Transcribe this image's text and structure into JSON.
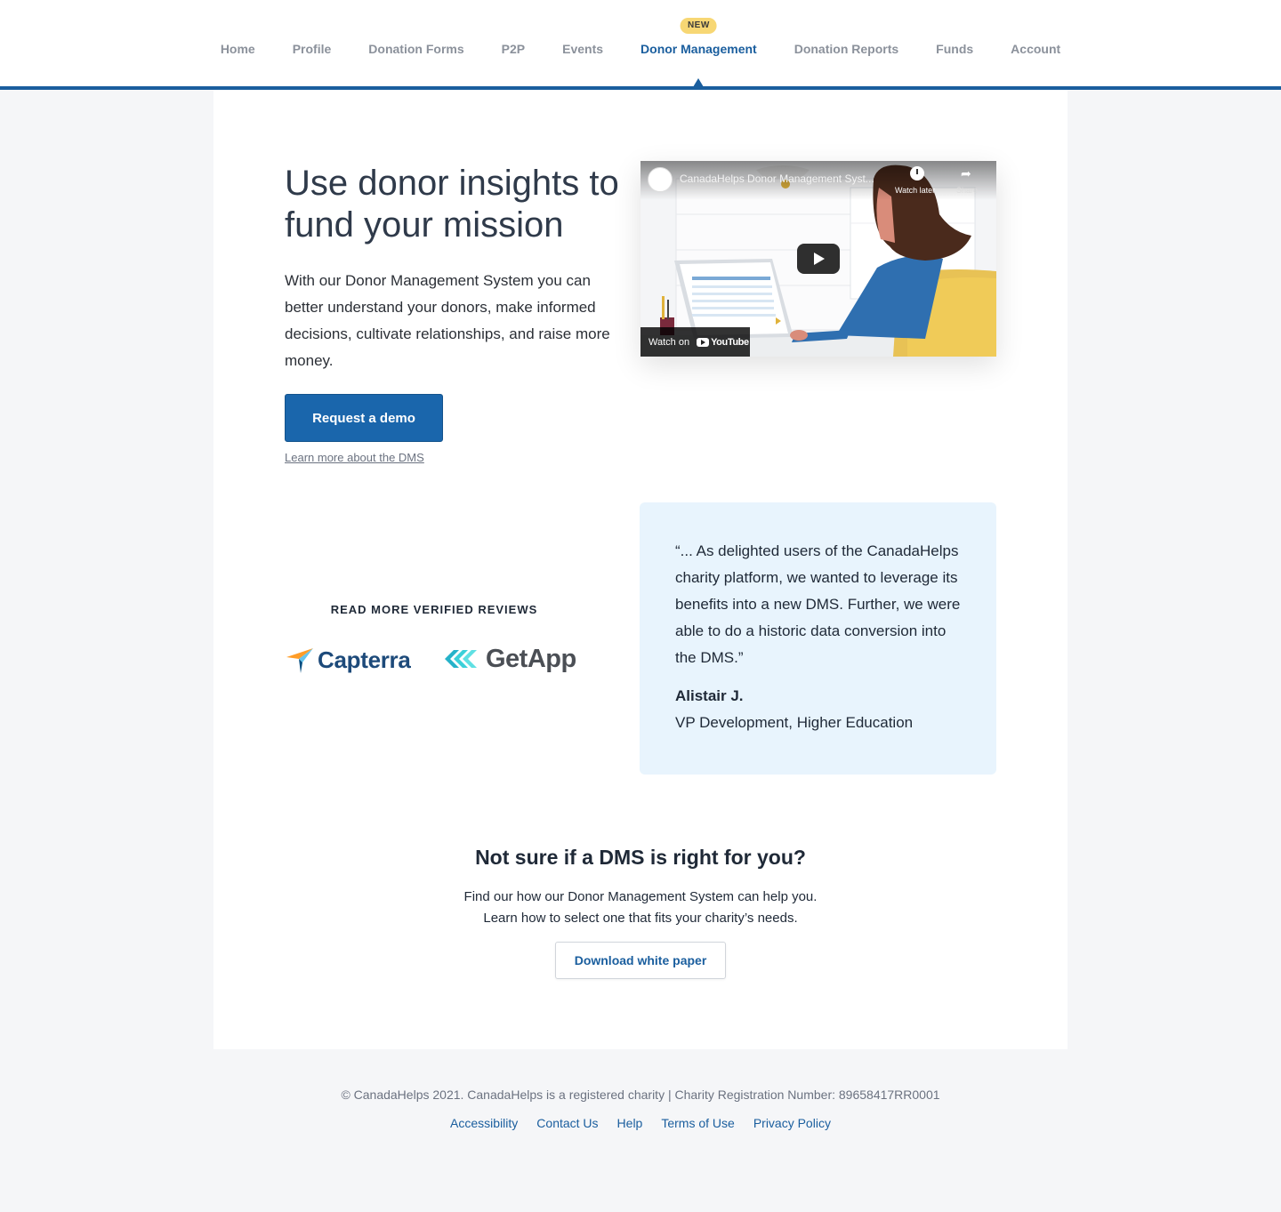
{
  "nav": {
    "items": [
      {
        "label": "Home"
      },
      {
        "label": "Profile"
      },
      {
        "label": "Donation Forms"
      },
      {
        "label": "P2P"
      },
      {
        "label": "Events"
      },
      {
        "label": "Donor Management",
        "badge": "NEW",
        "active": true
      },
      {
        "label": "Donation Reports"
      },
      {
        "label": "Funds"
      },
      {
        "label": "Account"
      }
    ]
  },
  "hero": {
    "title": "Use donor insights to fund your mission",
    "text": "With our Donor Management System you can better understand your donors, make informed decisions, cultivate relationships, and raise more money.",
    "demo_button": "Request a demo",
    "learn_link": "Learn more about the DMS"
  },
  "video": {
    "title": "CanadaHelps Donor Management Syst...",
    "watch_later": "Watch later",
    "share": "Share",
    "watch_on": "Watch on",
    "youtube": "YouTube"
  },
  "reviews": {
    "heading": "READ MORE VERIFIED REVIEWS",
    "capterra": "Capterra",
    "getapp": "GetApp"
  },
  "testimonial": {
    "quote": "“... As delighted users of the CanadaHelps charity platform, we wanted to leverage its benefits into a new DMS. Further, we were able to do a historic data conversion into the DMS.”",
    "author": "Alistair J.",
    "role": "VP Development, Higher Education"
  },
  "cta": {
    "title": "Not sure if a DMS is right for you?",
    "line1": "Find our how our Donor Management System can help you.",
    "line2": "Learn how to select one that fits your charity’s needs.",
    "button": "Download white paper"
  },
  "footer": {
    "copyright": "© CanadaHelps 2021. CanadaHelps is a registered charity | Charity Registration Number: 89658417RR0001",
    "links": [
      "Accessibility",
      "Contact Us",
      "Help",
      "Terms of Use",
      "Privacy Policy"
    ]
  },
  "colors": {
    "primary": "#1a66ac",
    "nav_active": "#1a5e9e",
    "badge": "#f7d774",
    "quote_bg": "#e8f4fd",
    "page_bg": "#f5f6f8"
  }
}
